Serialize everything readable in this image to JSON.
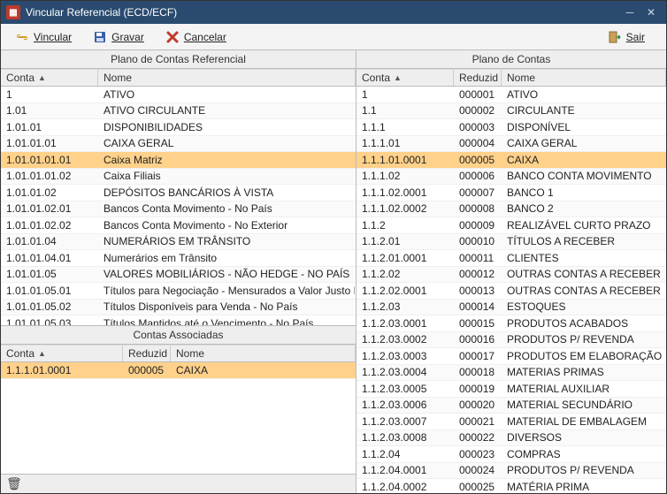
{
  "window": {
    "title": "Vincular Referencial (ECD/ECF)"
  },
  "toolbar": {
    "vincular": "Vincular",
    "gravar": "Gravar",
    "cancelar": "Cancelar",
    "sair": "Sair"
  },
  "panels": {
    "referencial_title": "Plano de Contas Referencial",
    "plano_title": "Plano de Contas",
    "associadas_title": "Contas Associadas"
  },
  "headers": {
    "conta": "Conta",
    "nome": "Nome",
    "reduzid": "Reduzid"
  },
  "referencial": {
    "selected_index": 5,
    "rows": [
      {
        "conta": "1",
        "nome": "ATIVO"
      },
      {
        "conta": "1.01",
        "nome": "ATIVO CIRCULANTE"
      },
      {
        "conta": "1.01.01",
        "nome": "DISPONIBILIDADES"
      },
      {
        "conta": "1.01.01.01",
        "nome": "CAIXA GERAL"
      },
      {
        "conta": "1.01.01.01.01",
        "nome": "Caixa Matriz"
      },
      {
        "conta": "1.01.01.01.02",
        "nome": "Caixa Filiais"
      },
      {
        "conta": "1.01.01.02",
        "nome": "DEPÓSITOS BANCÁRIOS À VISTA"
      },
      {
        "conta": "1.01.01.02.01",
        "nome": "Bancos Conta Movimento - No País"
      },
      {
        "conta": "1.01.01.02.02",
        "nome": "Bancos Conta Movimento - No Exterior"
      },
      {
        "conta": "1.01.01.04",
        "nome": "NUMERÁRIOS EM TRÂNSITO"
      },
      {
        "conta": "1.01.01.04.01",
        "nome": "Numerários em Trânsito"
      },
      {
        "conta": "1.01.01.05",
        "nome": "VALORES MOBILIÁRIOS  - NÃO HEDGE - NO PAÍS"
      },
      {
        "conta": "1.01.01.05.01",
        "nome": "Títulos para Negociação - Mensurados a Valor Justo Por Mei"
      },
      {
        "conta": "1.01.01.05.02",
        "nome": "Títulos Disponíveis para Venda - No País"
      },
      {
        "conta": "1.01.01.05.03",
        "nome": "Títulos Mantidos até o Vencimento - No País"
      }
    ]
  },
  "plano": {
    "selected_index": 4,
    "rows": [
      {
        "conta": "1",
        "reduz": "000001",
        "nome": "ATIVO"
      },
      {
        "conta": "1.1",
        "reduz": "000002",
        "nome": "CIRCULANTE"
      },
      {
        "conta": "1.1.1",
        "reduz": "000003",
        "nome": "DISPONÍVEL"
      },
      {
        "conta": "1.1.1.01",
        "reduz": "000004",
        "nome": "CAIXA GERAL"
      },
      {
        "conta": "1.1.1.01.0001",
        "reduz": "000005",
        "nome": "CAIXA"
      },
      {
        "conta": "1.1.1.02",
        "reduz": "000006",
        "nome": "BANCO CONTA MOVIMENTO"
      },
      {
        "conta": "1.1.1.02.0001",
        "reduz": "000007",
        "nome": "BANCO 1"
      },
      {
        "conta": "1.1.1.02.0002",
        "reduz": "000008",
        "nome": "BANCO 2"
      },
      {
        "conta": "1.1.2",
        "reduz": "000009",
        "nome": "REALIZÁVEL CURTO PRAZO"
      },
      {
        "conta": "1.1.2.01",
        "reduz": "000010",
        "nome": "TÍTULOS A RECEBER"
      },
      {
        "conta": "1.1.2.01.0001",
        "reduz": "000011",
        "nome": "CLIENTES"
      },
      {
        "conta": "1.1.2.02",
        "reduz": "000012",
        "nome": "OUTRAS CONTAS A RECEBER"
      },
      {
        "conta": "1.1.2.02.0001",
        "reduz": "000013",
        "nome": "OUTRAS CONTAS A RECEBER"
      },
      {
        "conta": "1.1.2.03",
        "reduz": "000014",
        "nome": "ESTOQUES"
      },
      {
        "conta": "1.1.2.03.0001",
        "reduz": "000015",
        "nome": "PRODUTOS ACABADOS"
      },
      {
        "conta": "1.1.2.03.0002",
        "reduz": "000016",
        "nome": "PRODUTOS P/ REVENDA"
      },
      {
        "conta": "1.1.2.03.0003",
        "reduz": "000017",
        "nome": "PRODUTOS EM ELABORAÇÃO"
      },
      {
        "conta": "1.1.2.03.0004",
        "reduz": "000018",
        "nome": "MATERIAS PRIMAS"
      },
      {
        "conta": "1.1.2.03.0005",
        "reduz": "000019",
        "nome": "MATERIAL AUXILIAR"
      },
      {
        "conta": "1.1.2.03.0006",
        "reduz": "000020",
        "nome": "MATERIAL SECUNDÁRIO"
      },
      {
        "conta": "1.1.2.03.0007",
        "reduz": "000021",
        "nome": "MATERIAL DE EMBALAGEM"
      },
      {
        "conta": "1.1.2.03.0008",
        "reduz": "000022",
        "nome": "DIVERSOS"
      },
      {
        "conta": "1.1.2.04",
        "reduz": "000023",
        "nome": "COMPRAS"
      },
      {
        "conta": "1.1.2.04.0001",
        "reduz": "000024",
        "nome": "PRODUTOS P/ REVENDA"
      },
      {
        "conta": "1.1.2.04.0002",
        "reduz": "000025",
        "nome": "MATÉRIA PRIMA"
      }
    ]
  },
  "associadas": {
    "selected_index": 0,
    "rows": [
      {
        "conta": "1.1.1.01.0001",
        "reduz": "000005",
        "nome": "CAIXA"
      }
    ]
  }
}
